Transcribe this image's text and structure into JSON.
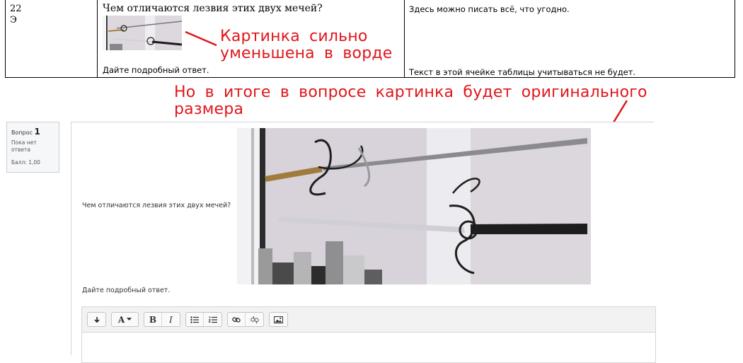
{
  "word_table": {
    "number_line1": "22",
    "number_line2": "Э",
    "question_text": "Чем отличаются лезвия этих двух мечей?",
    "answer_prompt": "Дайте подробный ответ.",
    "note_top": "Здесь можно писать всё, что угодно.",
    "note_bottom": "Текст в этой ячейке таблицы учитываться не будет."
  },
  "annotations": {
    "small_image_line1": "Картинка  сильно",
    "small_image_line2": "уменьшена  в  ворде",
    "original_size_line1": "Но  в  итоге  в  вопросе  картинка  будет  оригинального",
    "original_size_line2": "размера",
    "color": "#e0161b"
  },
  "question_info": {
    "label": "Вопрос",
    "number": "1",
    "status": "Пока нет ответа",
    "grade": "Балл: 1,00"
  },
  "question": {
    "text": "Чем отличаются лезвия этих двух мечей?",
    "prompt": "Дайте подробный ответ."
  },
  "editor_toolbar": [
    {
      "group": [
        "collapse-icon"
      ]
    },
    {
      "group": [
        "font-style-icon"
      ]
    },
    {
      "group": [
        "bold-icon",
        "italic-icon"
      ]
    },
    {
      "group": [
        "unordered-list-icon",
        "ordered-list-icon"
      ]
    },
    {
      "group": [
        "link-icon",
        "unlink-icon"
      ]
    },
    {
      "group": [
        "image-icon"
      ]
    }
  ],
  "editor_labels": {
    "bold": "B",
    "italic": "I",
    "font": "A"
  }
}
